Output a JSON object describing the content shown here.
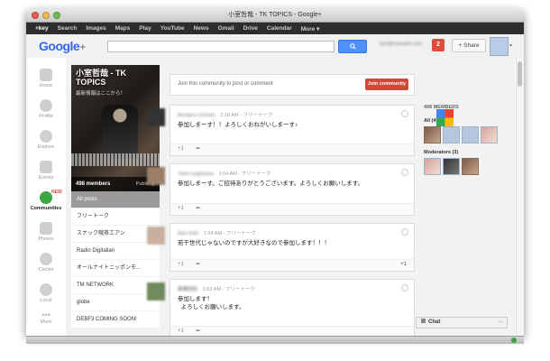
{
  "window": {
    "title": "小室哲哉 - TK TOPICS - Google+"
  },
  "gbar": {
    "items": [
      "+key",
      "Search",
      "Images",
      "Maps",
      "Play",
      "YouTube",
      "News",
      "Gmail",
      "Drive",
      "Calendar",
      "More ▾"
    ]
  },
  "header": {
    "logo": "Google",
    "logo_plus": "+",
    "notification_count": "2",
    "share_label": "+ Share",
    "caret": "▾"
  },
  "leftnav": {
    "items": [
      {
        "label": "Home",
        "icon": "home-icon"
      },
      {
        "label": "Profile",
        "icon": "profile-icon"
      },
      {
        "label": "Explore",
        "icon": "explore-icon"
      },
      {
        "label": "Events",
        "icon": "events-icon"
      },
      {
        "label": "Communities",
        "icon": "communities-icon",
        "badge": "NEW",
        "active": true
      },
      {
        "label": "Photos",
        "icon": "camera-icon"
      },
      {
        "label": "Circles",
        "icon": "circles-icon"
      },
      {
        "label": "Local",
        "icon": "local-icon"
      },
      {
        "label": "More",
        "icon": "more-icon"
      }
    ]
  },
  "community": {
    "title": "小室哲哉 - TK TOPICS",
    "subtitle": "最新情報はここから！",
    "member_count": "498 members",
    "visibility": "Public"
  },
  "categories": [
    "All posts",
    "フリートーク",
    "スナック哦茶エアン",
    "Radio Digitalian",
    "オールナイトニッポンモ…",
    "TM NETWORK",
    "globe",
    "DEBF3 COMING SOON!"
  ],
  "composer": {
    "prompt": "Join this community to post or comment",
    "join_label": "Join community"
  },
  "posts": [
    {
      "author": "Ryotaro nishino",
      "time": "2:18 AM",
      "category": "フリートーク",
      "body": "参加しまーす！！よろしくおねがいしまーす♪",
      "plus1": "+1",
      "right": ""
    },
    {
      "author": "Yuko sugiyama",
      "time": "1:04 AM",
      "category": "フリートーク",
      "body": "参加しまーす。ご招待ありがとうございます。よろしくお願いします。",
      "plus1": "+1",
      "right": ""
    },
    {
      "author": "Dan Seki",
      "time": "1:04 AM",
      "category": "フリートーク",
      "body": "若干世代じゃないのですが大好きなので参加します！！！",
      "plus1": "+1",
      "right": "+1"
    },
    {
      "author": "高橋浩和",
      "time": "1:03 AM",
      "category": "フリートーク",
      "body": "参加します！\n  よろしくお願いします。",
      "plus1": "+1",
      "right": ""
    }
  ],
  "members": {
    "title": "498 MEMBERS",
    "all_label": "All (498)",
    "moderators_label": "Moderators (3)"
  },
  "chat": {
    "label": "Chat",
    "close": "—"
  }
}
